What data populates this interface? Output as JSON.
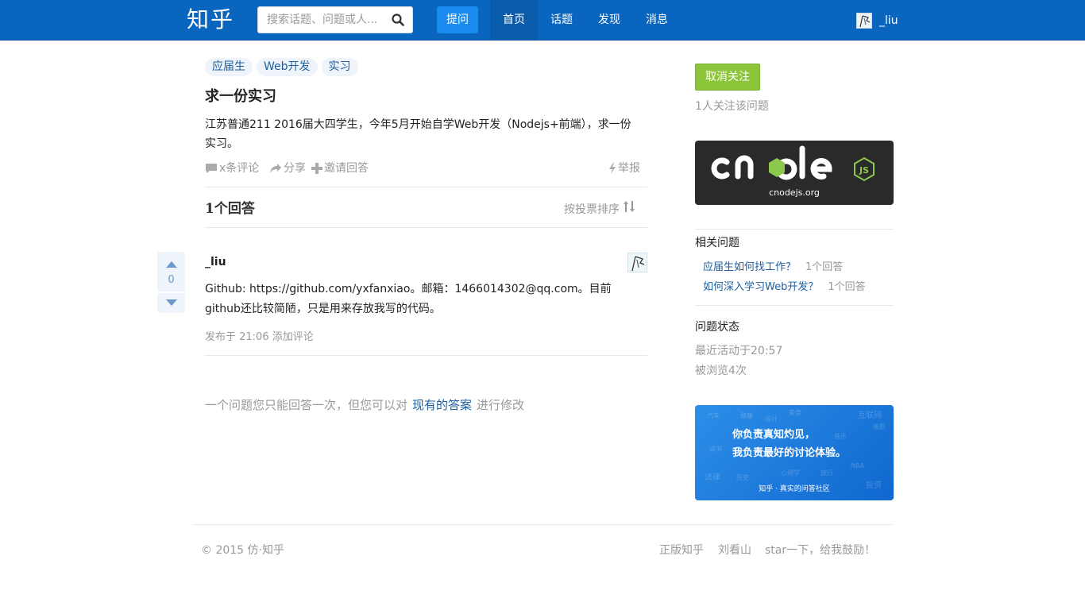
{
  "header": {
    "logo": "知乎",
    "search_placeholder": "搜索话题、问题或人...",
    "ask_label": "提问",
    "nav": [
      "首页",
      "话题",
      "发现",
      "消息"
    ],
    "username": "_liu"
  },
  "question": {
    "tags": [
      "应届生",
      "Web开发",
      "实习"
    ],
    "title": "求一份实习",
    "body": "江苏普通211 2016届大四学生，今年5月开始自学Web开发（Nodejs+前端），求一份实习。",
    "actions": {
      "comments": "x条评论",
      "share": "分享",
      "invite": "邀请回答",
      "report": "举报"
    }
  },
  "answers": {
    "count_label": "1个回答",
    "sort_label": "按投票排序",
    "items": [
      {
        "votes": "0",
        "author": "_liu",
        "body": "Github: https://github.com/yxfanxiao。邮箱：1466014302@qq.com。目前github还比较简陋，只是用来存放我写的代码。",
        "posted": "发布于 21:06",
        "add_comment": "添加评论"
      }
    ],
    "notice_prefix": "一个问题您只能回答一次，但您可以对",
    "notice_link": "现有的答案",
    "notice_suffix": "进行修改"
  },
  "sidebar": {
    "unfollow_label": "取消关注",
    "followers": "1人关注该问题",
    "cnode": {
      "brand": "cnode",
      "js": "JS",
      "url": "cnodejs.org"
    },
    "related_title": "相关问题",
    "related": [
      {
        "title": "应届生如何找工作？",
        "count": "1个回答"
      },
      {
        "title": "如何深入学习Web开发？",
        "count": "1个回答"
      }
    ],
    "status_title": "问题状态",
    "last_active": "最近活动于20:57",
    "views": "被浏览4次",
    "promo": {
      "line1": "你负责真知灼见，",
      "line2": "我负责最好的讨论体验。",
      "footer": "知乎 · 真实的问答社区",
      "bg_words": [
        "汽车",
        "健康",
        "设计",
        "美食",
        "互联网",
        "电影",
        "法律",
        "投资",
        "心理学",
        "旅行",
        "NBA",
        "音乐",
        "读书",
        "历史"
      ]
    }
  },
  "footer": {
    "copyright": "© 2015 仿·知乎",
    "links": [
      "正版知乎",
      "刘看山",
      "star一下，给我鼓励！"
    ]
  },
  "colors": {
    "header_bg": "#0a65bf",
    "ask_button": "#1a8cf0",
    "unfollow_button": "#8cc43a",
    "link": "#1e5fa0",
    "node_green": "#8cc84b"
  }
}
